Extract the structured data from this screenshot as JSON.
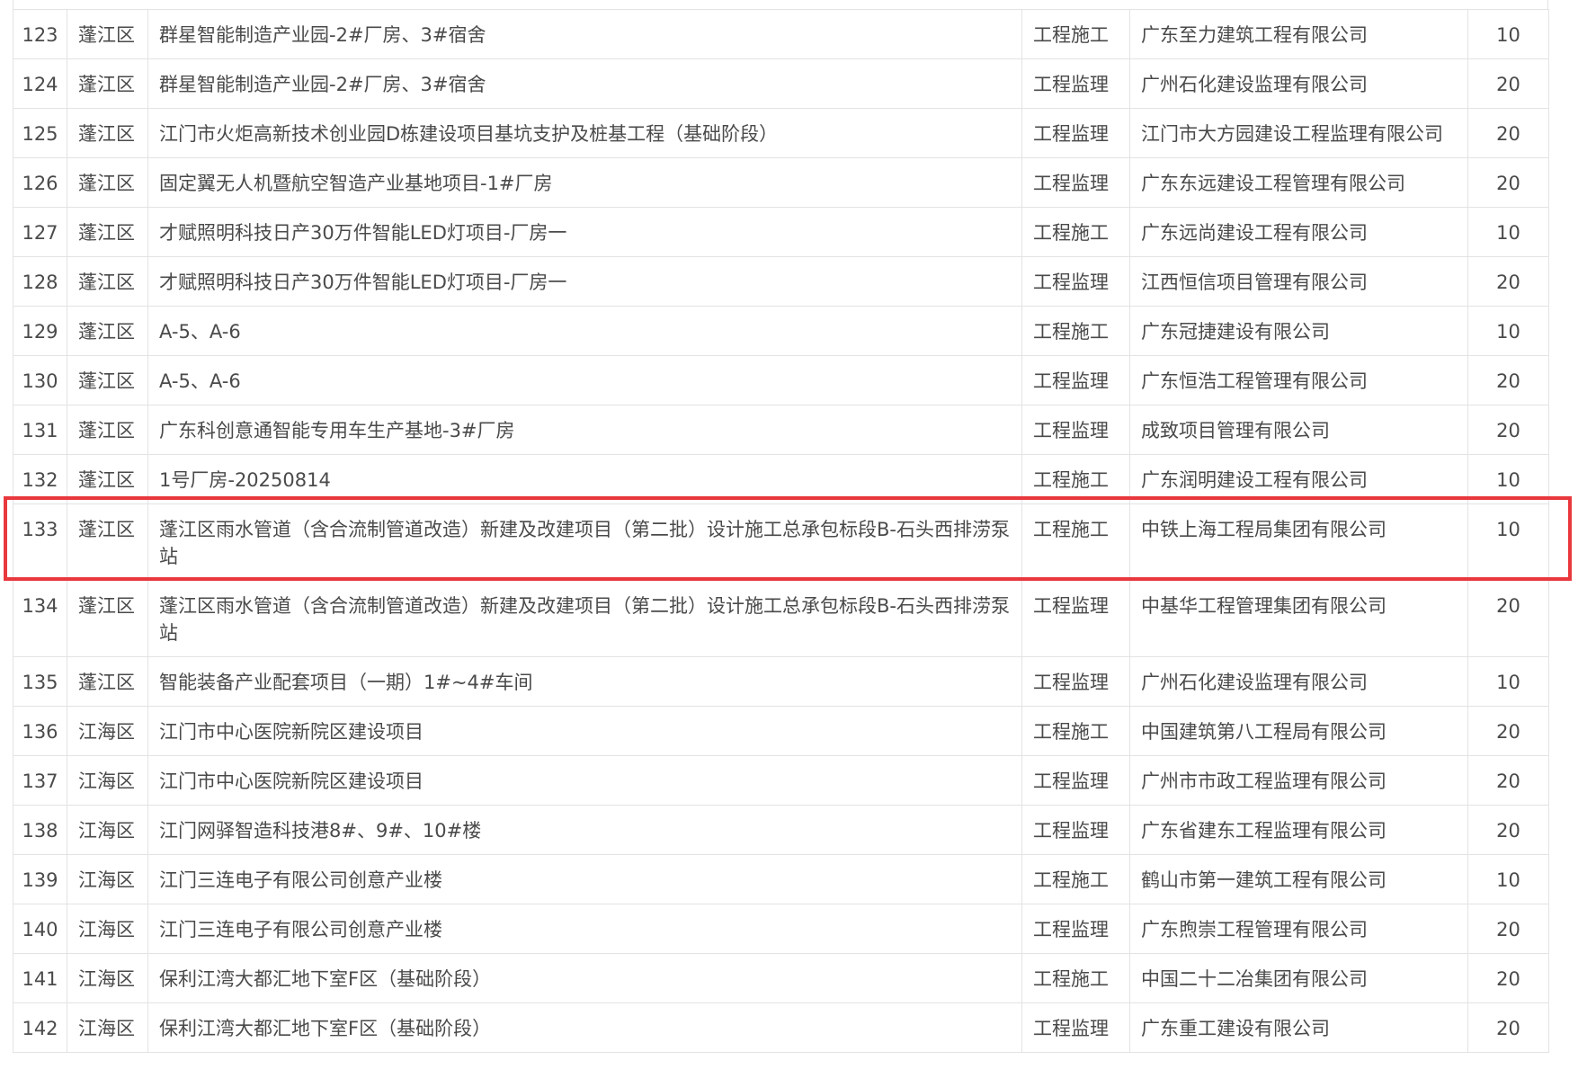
{
  "table": {
    "rows": [
      {
        "no": "123",
        "district": "蓬江区",
        "project": "群星智能制造产业园-2#厂房、3#宿舍",
        "type": "工程施工",
        "company": "广东至力建筑工程有限公司",
        "score": "10"
      },
      {
        "no": "124",
        "district": "蓬江区",
        "project": "群星智能制造产业园-2#厂房、3#宿舍",
        "type": "工程监理",
        "company": "广州石化建设监理有限公司",
        "score": "20"
      },
      {
        "no": "125",
        "district": "蓬江区",
        "project": "江门市火炬高新技术创业园D栋建设项目基坑支护及桩基工程（基础阶段）",
        "type": "工程监理",
        "company": "江门市大方园建设工程监理有限公司",
        "score": "20"
      },
      {
        "no": "126",
        "district": "蓬江区",
        "project": "固定翼无人机暨航空智造产业基地项目-1#厂房",
        "type": "工程监理",
        "company": "广东东远建设工程管理有限公司",
        "score": "20"
      },
      {
        "no": "127",
        "district": "蓬江区",
        "project": "才赋照明科技日产30万件智能LED灯项目-厂房一",
        "type": "工程施工",
        "company": "广东远尚建设工程有限公司",
        "score": "10"
      },
      {
        "no": "128",
        "district": "蓬江区",
        "project": "才赋照明科技日产30万件智能LED灯项目-厂房一",
        "type": "工程监理",
        "company": "江西恒信项目管理有限公司",
        "score": "20"
      },
      {
        "no": "129",
        "district": "蓬江区",
        "project": "A-5、A-6",
        "type": "工程施工",
        "company": "广东冠捷建设有限公司",
        "score": "10"
      },
      {
        "no": "130",
        "district": "蓬江区",
        "project": "A-5、A-6",
        "type": "工程监理",
        "company": "广东恒浩工程管理有限公司",
        "score": "20"
      },
      {
        "no": "131",
        "district": "蓬江区",
        "project": "广东科创意通智能专用车生产基地-3#厂房",
        "type": "工程监理",
        "company": "成致项目管理有限公司",
        "score": "20"
      },
      {
        "no": "132",
        "district": "蓬江区",
        "project": "1号厂房-20250814",
        "type": "工程施工",
        "company": "广东润明建设工程有限公司",
        "score": "10"
      },
      {
        "no": "133",
        "district": "蓬江区",
        "project": "蓬江区雨水管道（含合流制管道改造）新建及改建项目（第二批）设计施工总承包标段B-石头西排涝泵站",
        "type": "工程施工",
        "company": "中铁上海工程局集团有限公司",
        "score": "10"
      },
      {
        "no": "134",
        "district": "蓬江区",
        "project": "蓬江区雨水管道（含合流制管道改造）新建及改建项目（第二批）设计施工总承包标段B-石头西排涝泵站",
        "type": "工程监理",
        "company": "中基华工程管理集团有限公司",
        "score": "20"
      },
      {
        "no": "135",
        "district": "蓬江区",
        "project": "智能装备产业配套项目（一期）1#~4#车间",
        "type": "工程监理",
        "company": "广州石化建设监理有限公司",
        "score": "10"
      },
      {
        "no": "136",
        "district": "江海区",
        "project": "江门市中心医院新院区建设项目",
        "type": "工程施工",
        "company": "中国建筑第八工程局有限公司",
        "score": "20"
      },
      {
        "no": "137",
        "district": "江海区",
        "project": "江门市中心医院新院区建设项目",
        "type": "工程监理",
        "company": "广州市市政工程监理有限公司",
        "score": "20"
      },
      {
        "no": "138",
        "district": "江海区",
        "project": "江门网驿智造科技港8#、9#、10#楼",
        "type": "工程监理",
        "company": "广东省建东工程监理有限公司",
        "score": "20"
      },
      {
        "no": "139",
        "district": "江海区",
        "project": "江门三连电子有限公司创意产业楼",
        "type": "工程施工",
        "company": "鹤山市第一建筑工程有限公司",
        "score": "10"
      },
      {
        "no": "140",
        "district": "江海区",
        "project": "江门三连电子有限公司创意产业楼",
        "type": "工程监理",
        "company": "广东煦崇工程管理有限公司",
        "score": "20"
      },
      {
        "no": "141",
        "district": "江海区",
        "project": "保利江湾大都汇地下室F区（基础阶段）",
        "type": "工程施工",
        "company": "中国二十二冶集团有限公司",
        "score": "20"
      },
      {
        "no": "142",
        "district": "江海区",
        "project": "保利江湾大都汇地下室F区（基础阶段）",
        "type": "工程监理",
        "company": "广东重工建设有限公司",
        "score": "20"
      }
    ]
  },
  "colors": {
    "highlight_border": "#e8383d",
    "grid_line": "#e3e3e3",
    "text": "#4a4a4a"
  }
}
